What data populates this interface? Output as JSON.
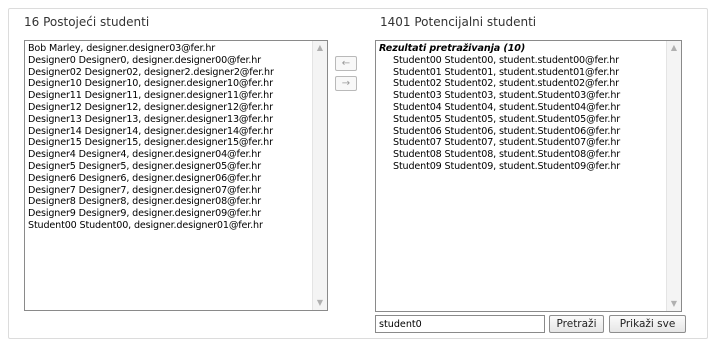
{
  "existing": {
    "heading": "16 Postojeći studenti",
    "items": [
      "Bob Marley, designer.designer03@fer.hr",
      "Designer0 Designer0, designer.designer00@fer.hr",
      "Designer02 Designer02, designer2.designer2@fer.hr",
      "Designer10 Designer10, designer.designer10@fer.hr",
      "Designer11 Designer11, designer.designer11@fer.hr",
      "Designer12 Designer12, designer.designer12@fer.hr",
      "Designer13 Designer13, designer.designer13@fer.hr",
      "Designer14 Designer14, designer.designer14@fer.hr",
      "Designer15 Designer15, designer.designer15@fer.hr",
      "Designer4 Designer4, designer.designer04@fer.hr",
      "Designer5 Designer5, designer.designer05@fer.hr",
      "Designer6 Designer6, designer.designer06@fer.hr",
      "Designer7 Designer7, designer.designer07@fer.hr",
      "Designer8 Designer8, designer.designer08@fer.hr",
      "Designer9 Designer9, designer.designer09@fer.hr",
      "Student00 Student00, designer.designer01@fer.hr"
    ]
  },
  "transfer": {
    "add_icon": "arrow-left-icon",
    "remove_icon": "arrow-right-icon",
    "add_label": "←",
    "remove_label": "→"
  },
  "potential": {
    "heading": "1401 Potencijalni studenti",
    "group_label": "Rezultati pretraživanja (10)",
    "items": [
      "Student00 Student00, student.student00@fer.hr",
      "Student01 Student01, student.student01@fer.hr",
      "Student02 Student02, student.student02@fer.hr",
      "Student03 Student03, student.Student03@fer.hr",
      "Student04 Student04, student.Student04@fer.hr",
      "Student05 Student05, student.Student05@fer.hr",
      "Student06 Student06, student.Student06@fer.hr",
      "Student07 Student07, student.Student07@fer.hr",
      "Student08 Student08, student.Student08@fer.hr",
      "Student09 Student09, student.Student09@fer.hr"
    ]
  },
  "search": {
    "value": "student0",
    "search_button": "Pretraži",
    "show_all_button": "Prikaži sve"
  },
  "scrollbar": {
    "up_icon": "scroll-up-icon",
    "down_icon": "scroll-down-icon"
  }
}
